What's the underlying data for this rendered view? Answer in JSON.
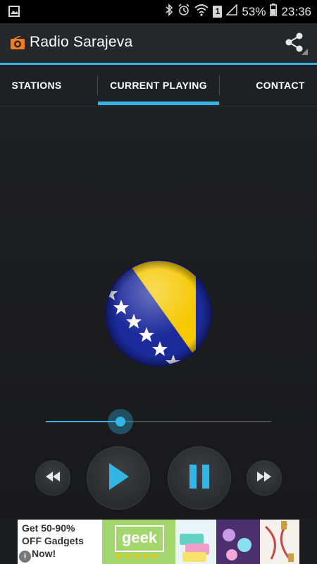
{
  "status_bar": {
    "battery": "53%",
    "time": "23:36",
    "sim_slot": "1",
    "icons": [
      "gallery-icon",
      "bluetooth-icon",
      "alarm-icon",
      "wifi-icon",
      "sim-icon",
      "signal-icon",
      "battery-icon"
    ]
  },
  "app": {
    "title": "Radio Sarajeva",
    "accent": "#33b5e5"
  },
  "tabs": [
    {
      "label": "STATIONS",
      "selected": false
    },
    {
      "label": "CURRENT PLAYING",
      "selected": true
    },
    {
      "label": "CONTACT",
      "selected": false
    }
  ],
  "player": {
    "station_image": "bosnia-flag",
    "seek_progress": 0.33
  },
  "ad": {
    "line1": "Get 50-90%",
    "line2": "OFF Gadgets",
    "line3": "Now!",
    "logo": "geek",
    "stars": "★★★★★"
  }
}
